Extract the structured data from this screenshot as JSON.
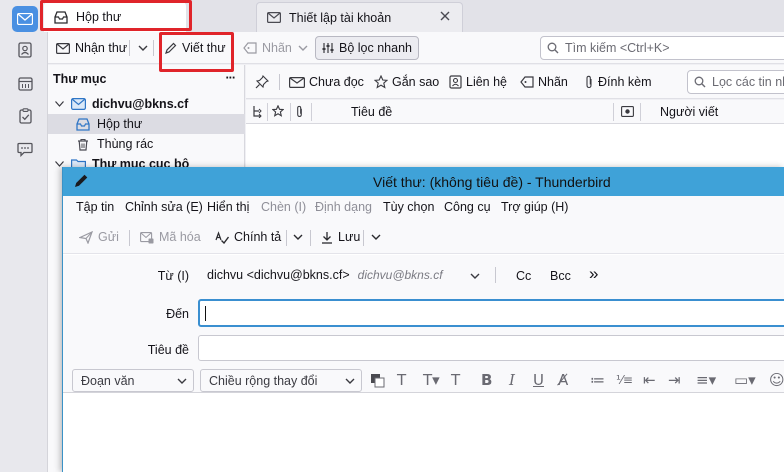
{
  "tabs": [
    {
      "label": "Hộp thư"
    },
    {
      "label": "Thiết lập tài khoản"
    }
  ],
  "toolbar": {
    "get_messages": "Nhận thư",
    "write": "Viết thư",
    "tag": "Nhãn",
    "quick_filter": "Bộ lọc nhanh",
    "search_placeholder": "Tìm kiếm <Ctrl+K>"
  },
  "folders": {
    "header": "Thư mục",
    "more": "···",
    "account": "dichvu@bkns.cf",
    "inbox": "Hộp thư",
    "trash": "Thùng rác",
    "local": "Thư mục cục bộ"
  },
  "quick_filter_bar": {
    "unread": "Chưa đọc",
    "starred": "Gắn sao",
    "contact": "Liên hệ",
    "tags": "Nhãn",
    "attachment": "Đính kèm",
    "filter_placeholder": "Lọc các tin nh"
  },
  "columns": {
    "subject": "Tiêu đề",
    "sender": "Người viết"
  },
  "compose": {
    "title": "Viết thư: (không tiêu đề) - Thunderbird",
    "menu": [
      {
        "label": "Tập tin",
        "disabled": false
      },
      {
        "label": "Chỉnh sửa (E)",
        "disabled": false
      },
      {
        "label": "Hiển thị",
        "disabled": false
      },
      {
        "label": "Chèn (I)",
        "disabled": true
      },
      {
        "label": "Định dạng",
        "disabled": true
      },
      {
        "label": "Tùy chọn",
        "disabled": false
      },
      {
        "label": "Công cụ",
        "disabled": false
      },
      {
        "label": "Trợ giúp (H)",
        "disabled": false
      }
    ],
    "toolbar": {
      "send": "Gửi",
      "encrypt": "Mã hóa",
      "spell": "Chính tả",
      "save": "Lưu"
    },
    "from_label": "Từ (I)",
    "from_name": "dichvu <dichvu@bkns.cf>",
    "from_identity": "dichvu@bkns.cf",
    "cc": "Cc",
    "bcc": "Bcc",
    "more": "»",
    "to_label": "Đến",
    "to_value": "",
    "subject_label": "Tiêu đề",
    "subject_value": "",
    "paragraph_format": "Đoạn văn",
    "font": "Chiều rộng thay đổi"
  },
  "colors": {
    "highlight": "#e0242a",
    "title_bar": "#3fa2d8",
    "accent": "#4a90e2"
  }
}
